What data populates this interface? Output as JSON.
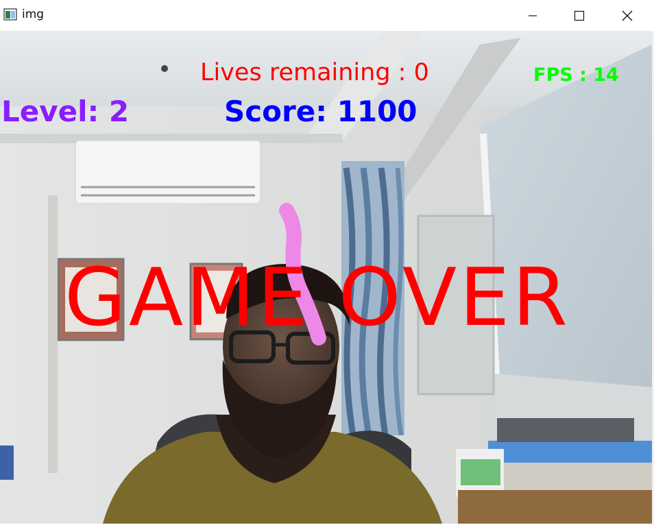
{
  "window": {
    "title": "img",
    "minimize_icon": "minimize-icon",
    "maximize_icon": "maximize-icon",
    "close_icon": "close-icon"
  },
  "hud": {
    "lives_text": "Lives remaining : 0",
    "fps_text": "FPS : 14",
    "level_text": "Level: 2",
    "score_text": "Score: 1100",
    "game_over_text": "GAME OVER"
  },
  "colors": {
    "lives": "#ff0000",
    "fps": "#00ff00",
    "level": "#8a1dff",
    "score": "#0000ff",
    "game_over": "#ff0000",
    "trail": "#ee88e6"
  }
}
